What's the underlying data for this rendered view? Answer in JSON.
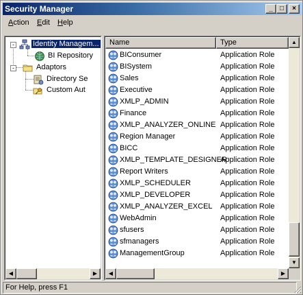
{
  "window": {
    "title": "Security Manager",
    "min_glyph": "_",
    "max_glyph": "□",
    "close_glyph": "×"
  },
  "menu": {
    "action": {
      "underline": "A",
      "rest": "ction"
    },
    "edit": {
      "underline": "E",
      "rest": "dit"
    },
    "help": {
      "underline": "H",
      "rest": "elp"
    }
  },
  "tree": {
    "root": {
      "label": "Identity Managem...",
      "expander": "-",
      "icon": "network-directory-icon"
    },
    "bi_repository": {
      "label": "BI Repository",
      "icon": "globe-database-icon"
    },
    "adaptors": {
      "label": "Adaptors",
      "expander": "-",
      "icon": "folder-icon"
    },
    "directory": {
      "label": "Directory Se",
      "icon": "directory-server-icon"
    },
    "custom": {
      "label": "Custom Aut",
      "icon": "key-folder-icon"
    }
  },
  "list": {
    "columns": {
      "name": "Name",
      "type": "Type"
    },
    "rows": [
      {
        "name": "BIConsumer",
        "type": "Application Role"
      },
      {
        "name": "BISystem",
        "type": "Application Role"
      },
      {
        "name": "Sales",
        "type": "Application Role"
      },
      {
        "name": "Executive",
        "type": "Application Role"
      },
      {
        "name": "XMLP_ADMIN",
        "type": "Application Role"
      },
      {
        "name": "Finance",
        "type": "Application Role"
      },
      {
        "name": "XMLP_ANALYZER_ONLINE",
        "type": "Application Role"
      },
      {
        "name": "Region Manager",
        "type": "Application Role"
      },
      {
        "name": "BICC",
        "type": "Application Role"
      },
      {
        "name": "XMLP_TEMPLATE_DESIGNER",
        "type": "Application Role"
      },
      {
        "name": "Report Writers",
        "type": "Application Role"
      },
      {
        "name": "XMLP_SCHEDULER",
        "type": "Application Role"
      },
      {
        "name": "XMLP_DEVELOPER",
        "type": "Application Role"
      },
      {
        "name": "XMLP_ANALYZER_EXCEL",
        "type": "Application Role"
      },
      {
        "name": "WebAdmin",
        "type": "Application Role"
      },
      {
        "name": "sfusers",
        "type": "Application Role"
      },
      {
        "name": "sfmanagers",
        "type": "Application Role"
      },
      {
        "name": "ManagementGroup",
        "type": "Application Role"
      }
    ]
  },
  "scroll": {
    "up": "▲",
    "down": "▼",
    "left": "◀",
    "right": "▶"
  },
  "status": {
    "text": "For Help, press F1"
  },
  "colors": {
    "title_start": "#0a246a",
    "title_end": "#a6caf0",
    "selection": "#0a246a",
    "face": "#d4d0c8"
  }
}
